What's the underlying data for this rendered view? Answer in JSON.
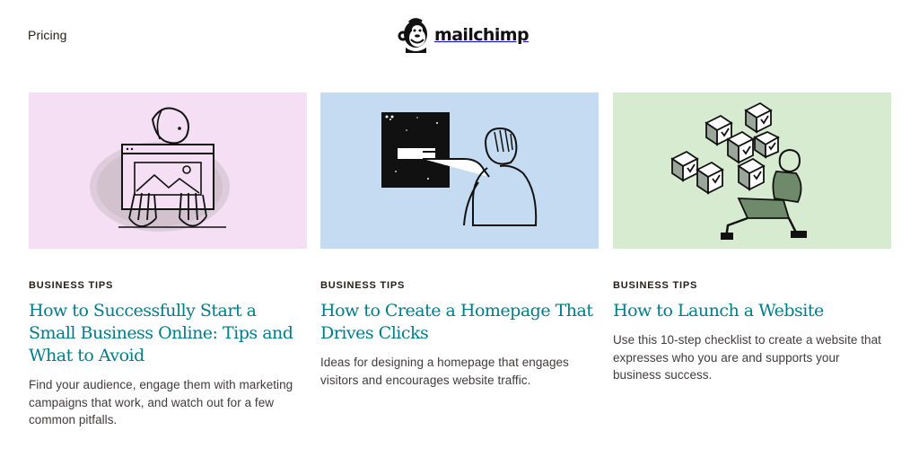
{
  "nav": {
    "pricing_label": "Pricing"
  },
  "logo": {
    "text": "mailchimp",
    "icon": "freddie-monkey-icon"
  },
  "cards": [
    {
      "category": "BUSINESS TIPS",
      "title": "How to Successfully Start a Small Business Online: Tips and What to Avoid",
      "description": "Find your audience, engage them with marketing campaigns that work, and watch out for a few common pitfalls.",
      "image_background": "#f5dff5",
      "illustration": "person-peeking-over-laptop"
    },
    {
      "category": "BUSINESS TIPS",
      "title": "How to Create a Homepage That Drives Clicks",
      "description": "Ideas for designing a homepage that engages visitors and encourages website traffic.",
      "image_background": "#c5dbf1",
      "illustration": "person-pointing-at-screen"
    },
    {
      "category": "BUSINESS TIPS",
      "title": "How to Launch a Website",
      "description": "Use this 10-step checklist to create a website that expresses who you are and supports your business success.",
      "image_background": "#d7ebd1",
      "illustration": "person-carrying-checkbox-cubes"
    }
  ],
  "colors": {
    "link_teal": "#007c89",
    "text_dark": "#241c15"
  }
}
